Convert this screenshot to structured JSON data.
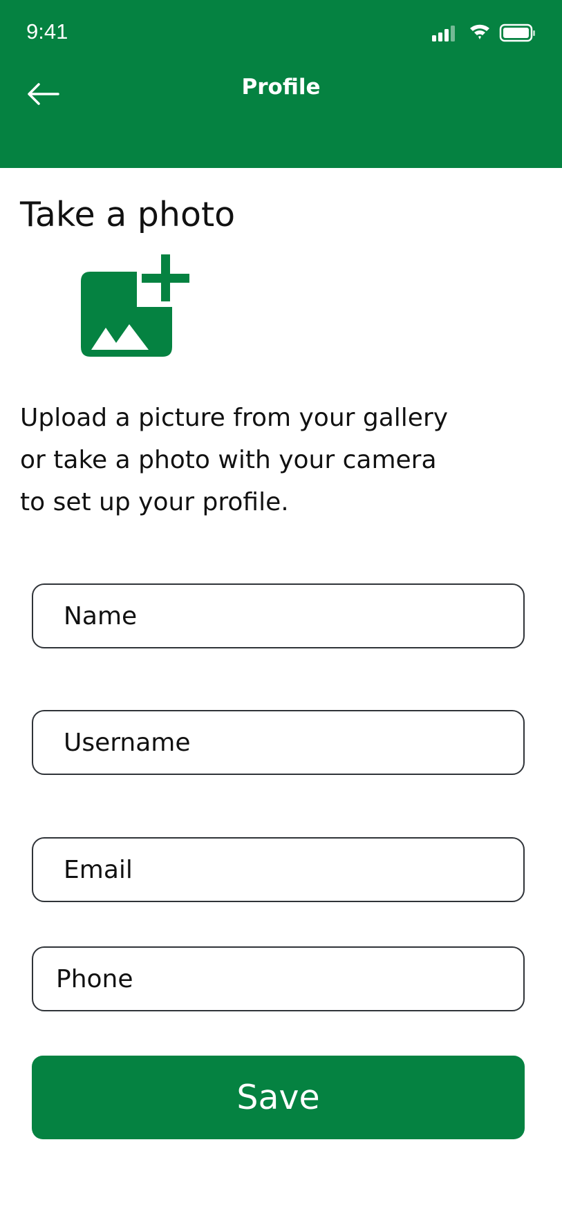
{
  "status_bar": {
    "time": "9:41"
  },
  "header": {
    "title": "Profile",
    "back_icon": "arrow-left-icon",
    "background_color": "#058241"
  },
  "photo_section": {
    "title": "Take a photo",
    "icon": "add-photo-icon",
    "description_lines": [
      "Upload a picture from your gallery",
      "or take a photo with your camera",
      "to set up your profile."
    ]
  },
  "form": {
    "name_placeholder": "Name",
    "username_placeholder": "Username",
    "email_placeholder": "Email",
    "phone_placeholder": "Phone"
  },
  "actions": {
    "save_label": "Save",
    "accent_color": "#058241"
  }
}
